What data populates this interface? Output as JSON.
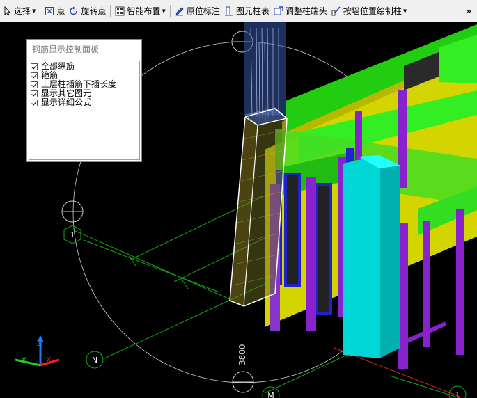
{
  "toolbar": {
    "select_label": "选择",
    "point_label": "点",
    "rotate_point_label": "旋转点",
    "smart_layout_label": "智能布置",
    "original_mark_label": "原位标注",
    "column_table_label": "图元柱表",
    "adjust_column_end_label": "调整柱端头",
    "draw_by_wall_label": "按墙位置绘制柱",
    "more_label": "»"
  },
  "panel": {
    "title": "钢筋显示控制面板",
    "options": [
      {
        "label": "全部纵筋",
        "checked": true
      },
      {
        "label": "箍筋",
        "checked": true
      },
      {
        "label": "上层柱插筋下插长度",
        "checked": true
      },
      {
        "label": "显示其它图元",
        "checked": true
      },
      {
        "label": "显示详细公式",
        "checked": true
      }
    ]
  },
  "viewport": {
    "axis_labels": {
      "n": "N",
      "m": "M",
      "one_left": "1",
      "one_right": "1"
    },
    "dimension": "3800",
    "axes": {
      "x": "X",
      "y": "Y",
      "z": "Z"
    }
  },
  "colors": {
    "beam": "#33dd22",
    "column": "#8822cc",
    "wall": "#cccc00",
    "highlight": "#00dddd",
    "grid": "#11aa11"
  }
}
